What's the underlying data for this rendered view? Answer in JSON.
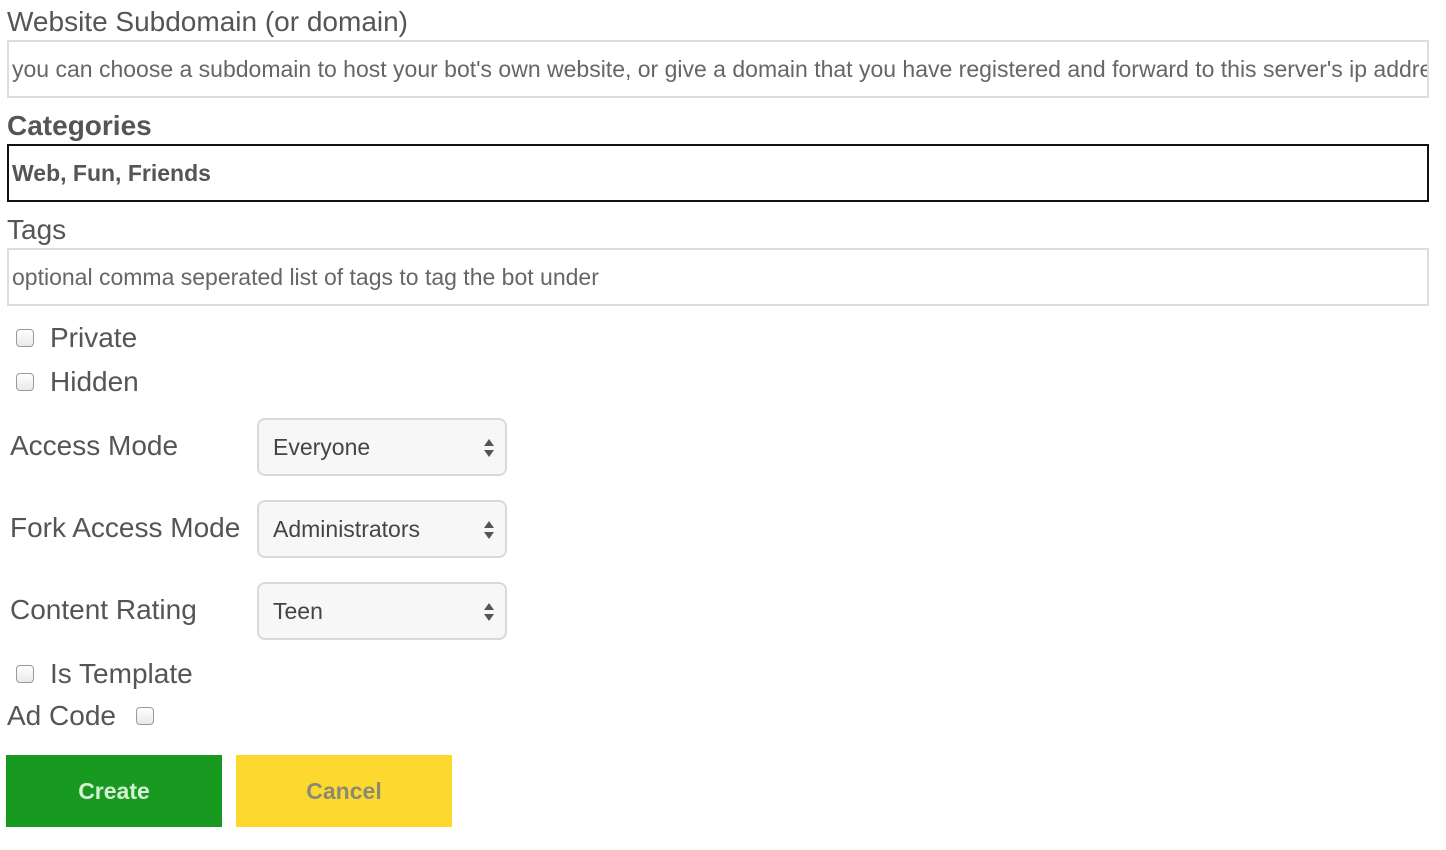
{
  "subdomain": {
    "label": "Website Subdomain (or domain)",
    "placeholder": "you can choose a subdomain to host your bot's own website, or give a domain that you have registered and forward to this server's ip address"
  },
  "categories": {
    "label": "Categories",
    "value": "Web, Fun, Friends"
  },
  "tags": {
    "label": "Tags",
    "placeholder": "optional comma seperated list of tags to tag the bot under"
  },
  "checkboxes": {
    "private": {
      "label": "Private",
      "checked": false
    },
    "hidden": {
      "label": "Hidden",
      "checked": false
    },
    "is_template": {
      "label": "Is Template",
      "checked": false
    },
    "ad_code": {
      "label": "Ad Code",
      "checked": false
    }
  },
  "selects": {
    "access_mode": {
      "label": "Access Mode",
      "value": "Everyone"
    },
    "fork_access_mode": {
      "label": "Fork Access Mode",
      "value": "Administrators"
    },
    "content_rating": {
      "label": "Content Rating",
      "value": "Teen"
    }
  },
  "buttons": {
    "create": "Create",
    "cancel": "Cancel"
  },
  "colors": {
    "create_bg": "#179a1f",
    "cancel_bg": "#fdd92f",
    "focused_border": "#111111",
    "input_border": "#dddddd"
  }
}
